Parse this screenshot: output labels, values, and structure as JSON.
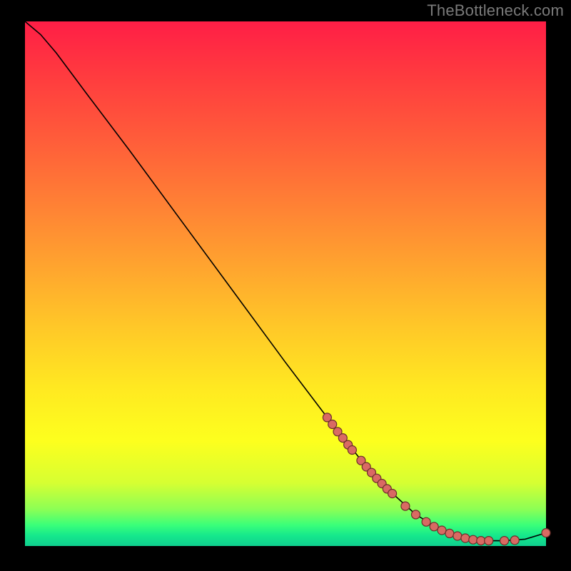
{
  "attribution": "TheBottleneck.com",
  "colors": {
    "page_bg": "#000000",
    "curve": "#000000",
    "marker_fill": "#d96a63",
    "marker_stroke": "#6a2e2a"
  },
  "chart_data": {
    "type": "line",
    "title": "",
    "xlabel": "",
    "ylabel": "",
    "xlim": [
      0,
      100
    ],
    "ylim": [
      0,
      100
    ],
    "grid": false,
    "legend": false,
    "curve": [
      {
        "x": 0.0,
        "y": 100.0
      },
      {
        "x": 3.0,
        "y": 97.5
      },
      {
        "x": 6.0,
        "y": 94.0
      },
      {
        "x": 9.0,
        "y": 90.0
      },
      {
        "x": 12.0,
        "y": 86.0
      },
      {
        "x": 20.0,
        "y": 75.5
      },
      {
        "x": 30.0,
        "y": 62.0
      },
      {
        "x": 40.0,
        "y": 48.5
      },
      {
        "x": 50.0,
        "y": 35.0
      },
      {
        "x": 58.0,
        "y": 24.5
      },
      {
        "x": 64.0,
        "y": 17.0
      },
      {
        "x": 70.0,
        "y": 10.5
      },
      {
        "x": 75.0,
        "y": 6.0
      },
      {
        "x": 80.0,
        "y": 3.0
      },
      {
        "x": 84.0,
        "y": 1.5
      },
      {
        "x": 88.0,
        "y": 1.0
      },
      {
        "x": 92.0,
        "y": 1.0
      },
      {
        "x": 96.0,
        "y": 1.3
      },
      {
        "x": 100.0,
        "y": 2.5
      }
    ],
    "markers": [
      {
        "x": 58.0,
        "y": 24.5
      },
      {
        "x": 59.0,
        "y": 23.2
      },
      {
        "x": 60.0,
        "y": 21.8
      },
      {
        "x": 61.0,
        "y": 20.6
      },
      {
        "x": 62.0,
        "y": 19.3
      },
      {
        "x": 62.8,
        "y": 18.3
      },
      {
        "x": 64.5,
        "y": 16.3
      },
      {
        "x": 65.5,
        "y": 15.1
      },
      {
        "x": 66.5,
        "y": 14.0
      },
      {
        "x": 67.5,
        "y": 12.9
      },
      {
        "x": 68.5,
        "y": 11.9
      },
      {
        "x": 69.5,
        "y": 10.9
      },
      {
        "x": 70.5,
        "y": 10.0
      },
      {
        "x": 73.0,
        "y": 7.6
      },
      {
        "x": 75.0,
        "y": 6.0
      },
      {
        "x": 77.0,
        "y": 4.6
      },
      {
        "x": 78.5,
        "y": 3.7
      },
      {
        "x": 80.0,
        "y": 3.0
      },
      {
        "x": 81.5,
        "y": 2.4
      },
      {
        "x": 83.0,
        "y": 1.9
      },
      {
        "x": 84.5,
        "y": 1.5
      },
      {
        "x": 86.0,
        "y": 1.2
      },
      {
        "x": 87.5,
        "y": 1.0
      },
      {
        "x": 89.0,
        "y": 1.0
      },
      {
        "x": 92.0,
        "y": 1.0
      },
      {
        "x": 94.0,
        "y": 1.1
      },
      {
        "x": 100.0,
        "y": 2.5
      }
    ]
  }
}
